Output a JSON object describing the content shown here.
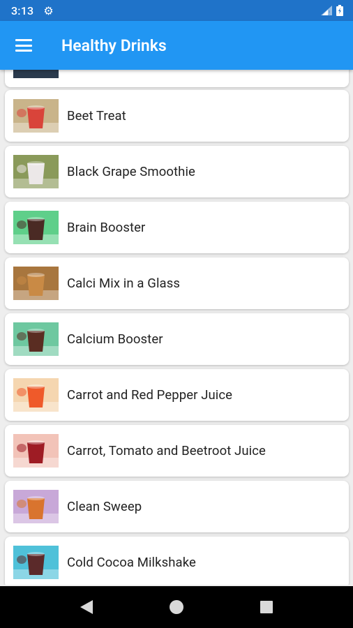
{
  "status_bar": {
    "time": "3:13"
  },
  "app_bar": {
    "title": "Healthy Drinks"
  },
  "drinks": [
    {
      "name": "Beet Treat",
      "thumb_color": "#d9443a",
      "bg_color": "#c9b48a"
    },
    {
      "name": "Black Grape Smoothie",
      "thumb_color": "#ece8e8",
      "bg_color": "#8a9a5a"
    },
    {
      "name": "Brain Booster",
      "thumb_color": "#4a2a24",
      "bg_color": "#5fcf8a"
    },
    {
      "name": "Calci Mix in a Glass",
      "thumb_color": "#c98a45",
      "bg_color": "#a8763e"
    },
    {
      "name": "Calcium Booster",
      "thumb_color": "#5a2d22",
      "bg_color": "#6ec8a0"
    },
    {
      "name": "Carrot and Red Pepper Juice",
      "thumb_color": "#ef5a2a",
      "bg_color": "#f5d6b0"
    },
    {
      "name": "Carrot, Tomato and Beetroot Juice",
      "thumb_color": "#9e1c24",
      "bg_color": "#f2c3b8"
    },
    {
      "name": "Clean Sweep",
      "thumb_color": "#d9742e",
      "bg_color": "#c8a8d8"
    },
    {
      "name": "Cold Cocoa Milkshake",
      "thumb_color": "#5b2a2a",
      "bg_color": "#4fc1d9"
    }
  ]
}
